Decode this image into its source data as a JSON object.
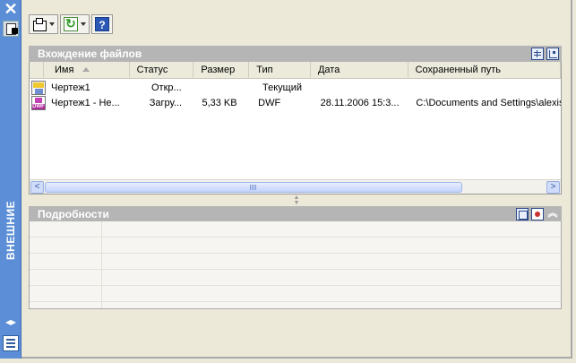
{
  "window": {
    "title": "ВНЕШНИЕ ССЫЛКИ",
    "close_glyph": "✕",
    "resize_glyph": "◂▸"
  },
  "icons": {
    "close": "close-icon",
    "pin": "properties-icon",
    "attach": "attach-dwg-icon",
    "refresh": "refresh-icon",
    "help": "help-icon",
    "list_view": "list-view-icon",
    "tree_view": "tree-view-icon",
    "details": "details-icon",
    "preview": "preview-icon",
    "collapse": "collapse-icon"
  },
  "toolbar": {
    "help_label": "?",
    "collapse_glyph": "︽"
  },
  "file_refs": {
    "header": "Вхождение файлов",
    "columns": [
      "Имя",
      "Статус",
      "Размер",
      "Тип",
      "Дата",
      "Сохраненный путь"
    ],
    "sorted_column": "Имя",
    "rows": [
      {
        "icon": "dwg-file-icon",
        "name": "Чертеж1",
        "status": "Откр...",
        "size": "",
        "type": "Текущий",
        "date": "",
        "path": ""
      },
      {
        "icon": "dwf-file-icon",
        "name": "Чертеж1 - Не...",
        "status": "Загру...",
        "size": "5,33 KB",
        "type": "DWF",
        "date": "28.11.2006 15:3...",
        "path": "C:\\Documents and Settings\\alexis\\"
      }
    ]
  },
  "scrollbar": {
    "left_glyph": "<",
    "right_glyph": ">"
  },
  "details": {
    "header": "Подробности"
  },
  "colors": {
    "strip": "#5b8ed6",
    "section_header": "#b5b5b5",
    "background": "#ece9d8"
  }
}
